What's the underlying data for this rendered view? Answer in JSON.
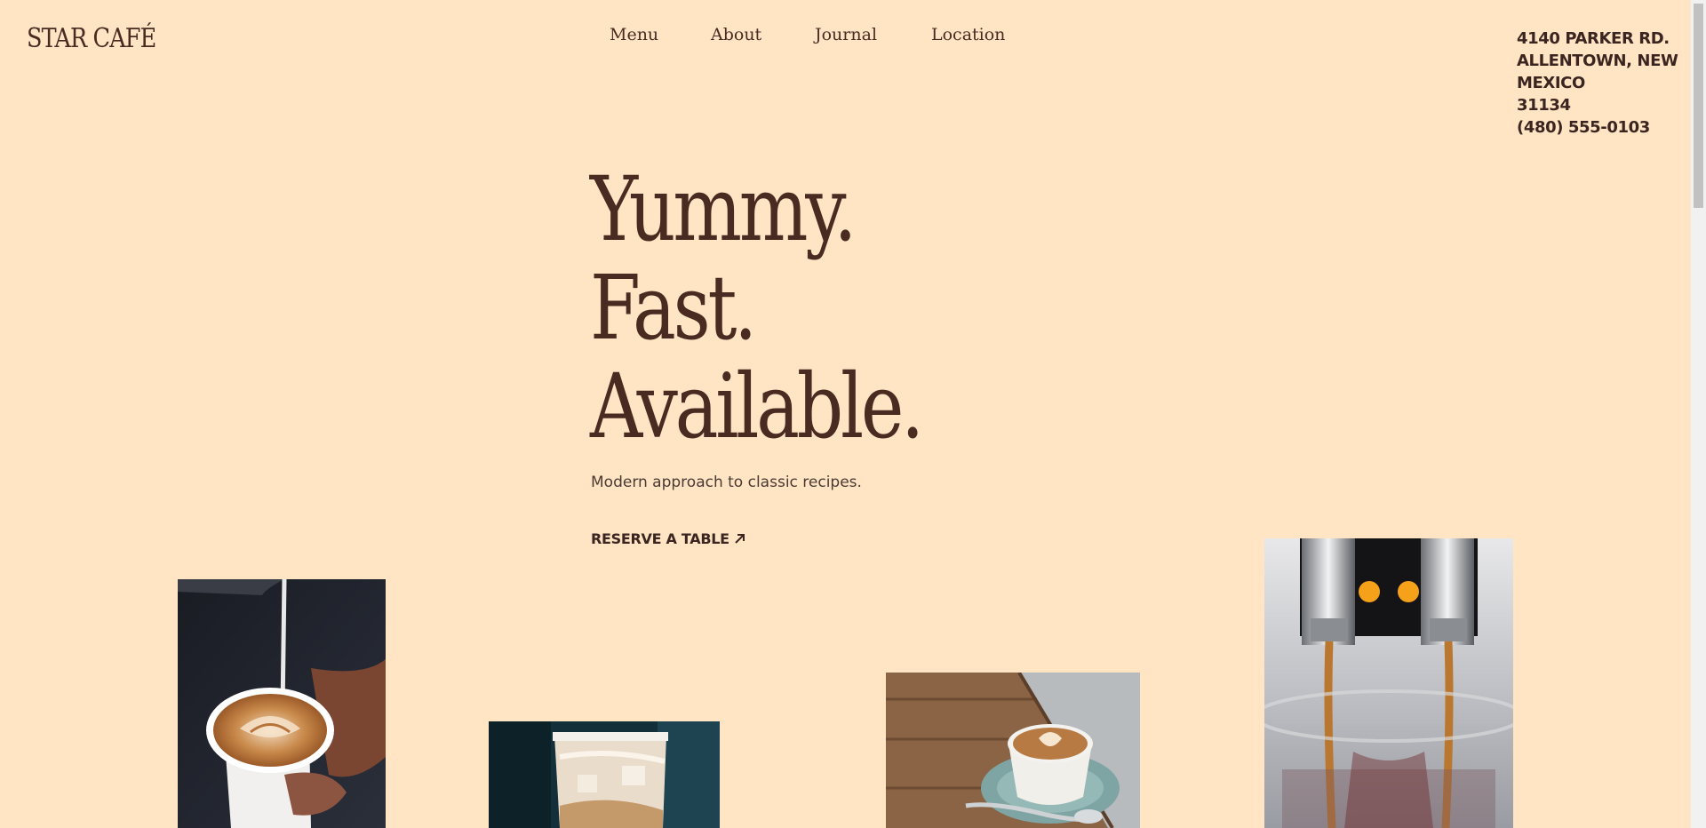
{
  "brand": {
    "logo_text": "STAR CAFÉ"
  },
  "nav": {
    "items": [
      {
        "label": "Menu"
      },
      {
        "label": "About"
      },
      {
        "label": "Journal"
      },
      {
        "label": "Location"
      }
    ]
  },
  "contact": {
    "address_lines": [
      "4140 PARKER RD.",
      "ALLENTOWN, NEW",
      "MEXICO",
      "31134"
    ],
    "phone": "(480) 555-0103"
  },
  "hero": {
    "lines": [
      "Yummy.",
      "Fast.",
      "Available."
    ],
    "subtitle": "Modern approach to classic recipes.",
    "cta_label": "RESERVE A TABLE",
    "cta_icon": "arrow-up-right-icon"
  },
  "gallery": [
    {
      "name": "latte-art-pour-photo"
    },
    {
      "name": "iced-latte-photo"
    },
    {
      "name": "cappuccino-on-table-photo"
    },
    {
      "name": "espresso-machine-photo"
    }
  ],
  "colors": {
    "background": "#ffe5c4",
    "text": "#4a2b22"
  }
}
